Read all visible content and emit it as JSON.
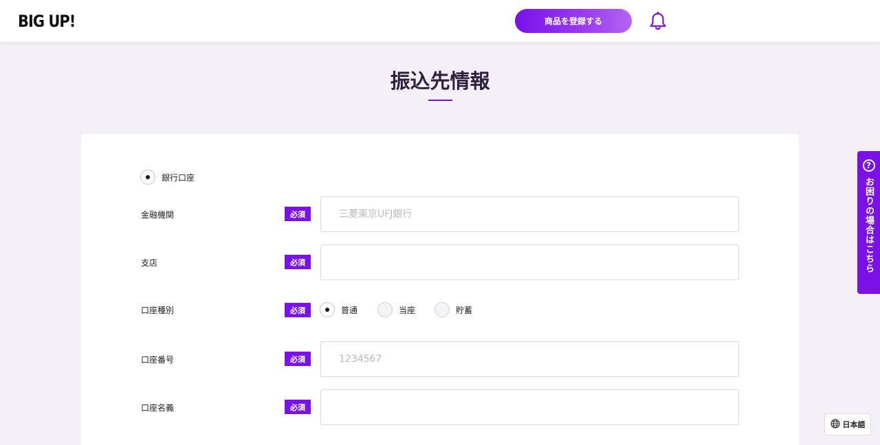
{
  "header": {
    "logo": "BIG UP!",
    "register_button": "商品を登録する",
    "bell_icon": "bell-icon"
  },
  "page": {
    "title": "振込先情報"
  },
  "form": {
    "bank_account_option": "銀行口座",
    "required_badge": "必須",
    "fields": {
      "institution": {
        "label": "金融機関",
        "placeholder": "三菱東京UFJ銀行",
        "value": ""
      },
      "branch": {
        "label": "支店",
        "placeholder": "",
        "value": ""
      },
      "account_type": {
        "label": "口座種別",
        "options": [
          "普通",
          "当座",
          "貯蓄"
        ],
        "selected": "普通"
      },
      "account_number": {
        "label": "口座番号",
        "placeholder": "1234567",
        "value": ""
      },
      "account_name": {
        "label": "口座名義",
        "placeholder": "",
        "value": ""
      }
    }
  },
  "help_tab": {
    "icon": "question-circle-icon",
    "label": "お困りの場合はこちら"
  },
  "language": {
    "icon": "globe-icon",
    "label": "日本語"
  },
  "colors": {
    "accent": "#7a12e8",
    "background": "#f3f1f7"
  }
}
